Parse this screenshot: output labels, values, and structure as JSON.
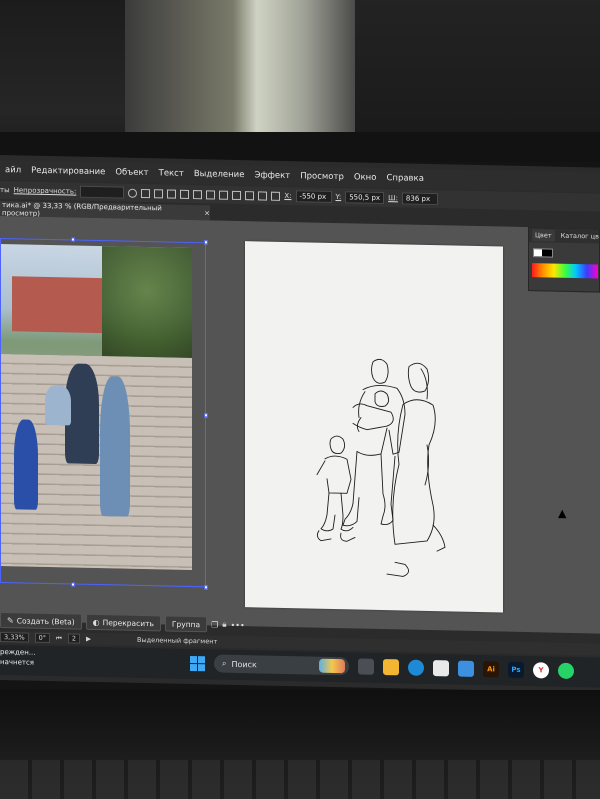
{
  "menu": [
    "айл",
    "Редактирование",
    "Объект",
    "Текст",
    "Выделение",
    "Эффект",
    "Просмотр",
    "Окно",
    "Справка"
  ],
  "control_bar": {
    "left_label": "ты",
    "opacity_label": "Непрозрачность:",
    "x_label": "X:",
    "x_value": "-550 px",
    "y_label": "Y:",
    "y_value": "550,5 px",
    "w_label": "Ш:",
    "w_value": "836 px"
  },
  "document_tab": {
    "title": "тика.ai* @ 33,33 % (RGB/Предварительный просмотр)",
    "close": "×"
  },
  "color_panel": {
    "tab_color": "Цвет",
    "tab_catalog": "Каталог цв"
  },
  "context_bar": {
    "create_label": "Создать (Beta)",
    "recolor_label": "Перекрасить",
    "group_label": "Группа",
    "more": "•••"
  },
  "status_bar": {
    "zoom": "3,33%",
    "rotation": "0°",
    "artboard_number": "2",
    "selection_label": "Выделенный фрагмент"
  },
  "notification": {
    "line1": "режден...",
    "line2": "начнется"
  },
  "taskbar": {
    "search_placeholder": "Поиск",
    "apps": [
      {
        "name": "ai",
        "label": "Ai",
        "color": "#2a1406",
        "text_color": "#ff9a00"
      },
      {
        "name": "ps",
        "label": "Ps",
        "color": "#0a1a2d",
        "text_color": "#31a8ff"
      },
      {
        "name": "yandex",
        "label": "Y",
        "color": "#ffffff",
        "text_color": "#e03030"
      },
      {
        "name": "whatsapp",
        "label": "",
        "color": "#25d366",
        "text_color": "#ffffff"
      }
    ]
  },
  "colors": {
    "selection_blue": "#4d63ff",
    "menubar": "#2d2d2d",
    "workspace": "#545454"
  }
}
